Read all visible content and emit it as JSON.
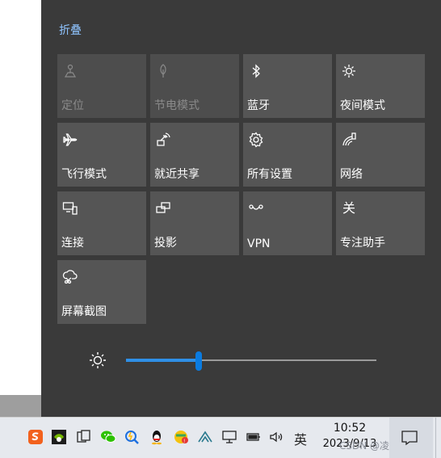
{
  "action_center": {
    "collapse_label": "折叠",
    "tiles": [
      {
        "label": "定位",
        "icon": "location-icon",
        "enabled": false
      },
      {
        "label": "节电模式",
        "icon": "battery-saver-icon",
        "enabled": false
      },
      {
        "label": "蓝牙",
        "icon": "bluetooth-icon",
        "enabled": true
      },
      {
        "label": "夜间模式",
        "icon": "night-light-icon",
        "enabled": true
      },
      {
        "label": "飞行模式",
        "icon": "airplane-icon",
        "enabled": true
      },
      {
        "label": "就近共享",
        "icon": "nearby-share-icon",
        "enabled": true
      },
      {
        "label": "所有设置",
        "icon": "gear-icon",
        "enabled": true
      },
      {
        "label": "网络",
        "icon": "network-icon",
        "enabled": true
      },
      {
        "label": "连接",
        "icon": "connect-icon",
        "enabled": true
      },
      {
        "label": "投影",
        "icon": "project-icon",
        "enabled": true
      },
      {
        "label": "VPN",
        "icon": "vpn-icon",
        "enabled": true
      },
      {
        "label": "专注助手",
        "icon": "focus-assist-icon",
        "icon_text": "关",
        "enabled": true
      },
      {
        "label": "屏幕截图",
        "icon": "screen-snip-icon",
        "enabled": true
      }
    ],
    "brightness": {
      "icon": "brightness-icon",
      "value_percent": 29
    }
  },
  "taskbar": {
    "tray_icons": [
      "sogou-input-icon",
      "nvidia-icon",
      "task-view-icon",
      "wechat-icon",
      "lightning-app-icon",
      "qq-icon",
      "browser-app-icon",
      "cloud-app-icon",
      "display-icon",
      "battery-icon",
      "volume-icon"
    ],
    "language": "英",
    "time": "10:52",
    "date": "2023/9/13",
    "watermark": "CSDN @凌康ACG"
  },
  "colors": {
    "accent": "#0a7be0",
    "panel_bg": "#3a3a3a",
    "tile_bg": "#555555"
  }
}
